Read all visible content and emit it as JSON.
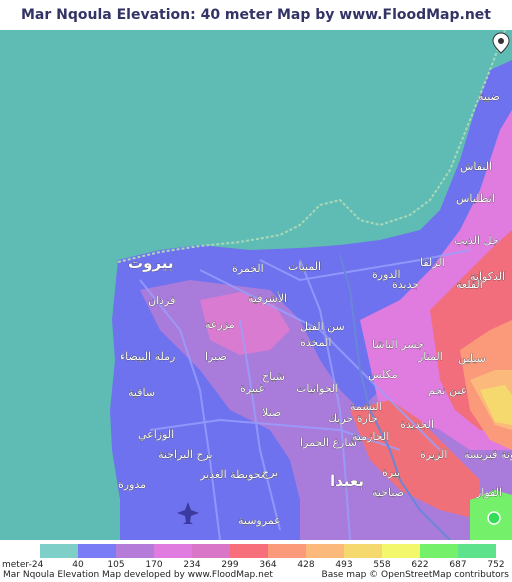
{
  "title": "Mar Nqoula Elevation: 40 meter Map by www.FloodMap.net (beta)",
  "map": {
    "labels": [
      {
        "text": "بيروت",
        "cls": "lbl-big"
      },
      {
        "text": "فردان"
      },
      {
        "text": "مزرعة"
      },
      {
        "text": "الخمرة"
      },
      {
        "text": "المنيات"
      },
      {
        "text": "الدورة"
      },
      {
        "text": "الأشرفية"
      },
      {
        "text": "سن الفيل"
      },
      {
        "text": "جديدة"
      },
      {
        "text": "الزلقا"
      },
      {
        "text": "جسر الباشا"
      },
      {
        "text": "المنار"
      },
      {
        "text": "رملة البيضاء"
      },
      {
        "text": "ساقية"
      },
      {
        "text": "صبرا"
      },
      {
        "text": "المخدة"
      },
      {
        "text": "الجوانيات"
      },
      {
        "text": "مكلس"
      },
      {
        "text": "عين نجم"
      },
      {
        "text": "شياح"
      },
      {
        "text": "غبيرة"
      },
      {
        "text": "الوزاعي"
      },
      {
        "text": "برج البراجنة"
      },
      {
        "text": "تحويطة الغدير"
      },
      {
        "text": "صنلا"
      },
      {
        "text": "شارع الحمرا"
      },
      {
        "text": "حارة حريك"
      },
      {
        "text": "البشمة"
      },
      {
        "text": "الجديدة"
      },
      {
        "text": "بعبدا",
        "cls": "lbl-big"
      },
      {
        "text": "الزيرة"
      },
      {
        "text": "بيرة"
      },
      {
        "text": "صباحية"
      },
      {
        "text": "عمروسية"
      },
      {
        "text": "مدورة"
      },
      {
        "text": "القلعة"
      },
      {
        "text": "انطلياس"
      },
      {
        "text": "جل الديب"
      },
      {
        "text": "النقاش"
      },
      {
        "text": "ضبية"
      },
      {
        "text": "الفوار"
      },
      {
        "text": "مونة قبريسة"
      },
      {
        "text": "سبلين"
      },
      {
        "text": "الحازمية"
      },
      {
        "text": "برج"
      },
      {
        "text": "الدكوانة"
      }
    ],
    "marker": "Mar Nqoula",
    "marker_icon": "map-pin-icon"
  },
  "legend": {
    "unit": "meter",
    "ticks": [
      "-24",
      "40",
      "105",
      "170",
      "234",
      "299",
      "364",
      "428",
      "493",
      "558",
      "622",
      "687",
      "752"
    ],
    "colors": [
      "#7ecfc7",
      "#7a7cf5",
      "#b57bd9",
      "#e07be0",
      "#d976c8",
      "#f76f7a",
      "#fa9a7a",
      "#fbb97c",
      "#f6d96e",
      "#f3f76c",
      "#75f06a",
      "#5ee28c"
    ]
  },
  "footer": {
    "left": "Mar Nqoula Elevation Map developed by www.FloodMap.net",
    "right": "Base map © OpenStreetMap contributors"
  }
}
